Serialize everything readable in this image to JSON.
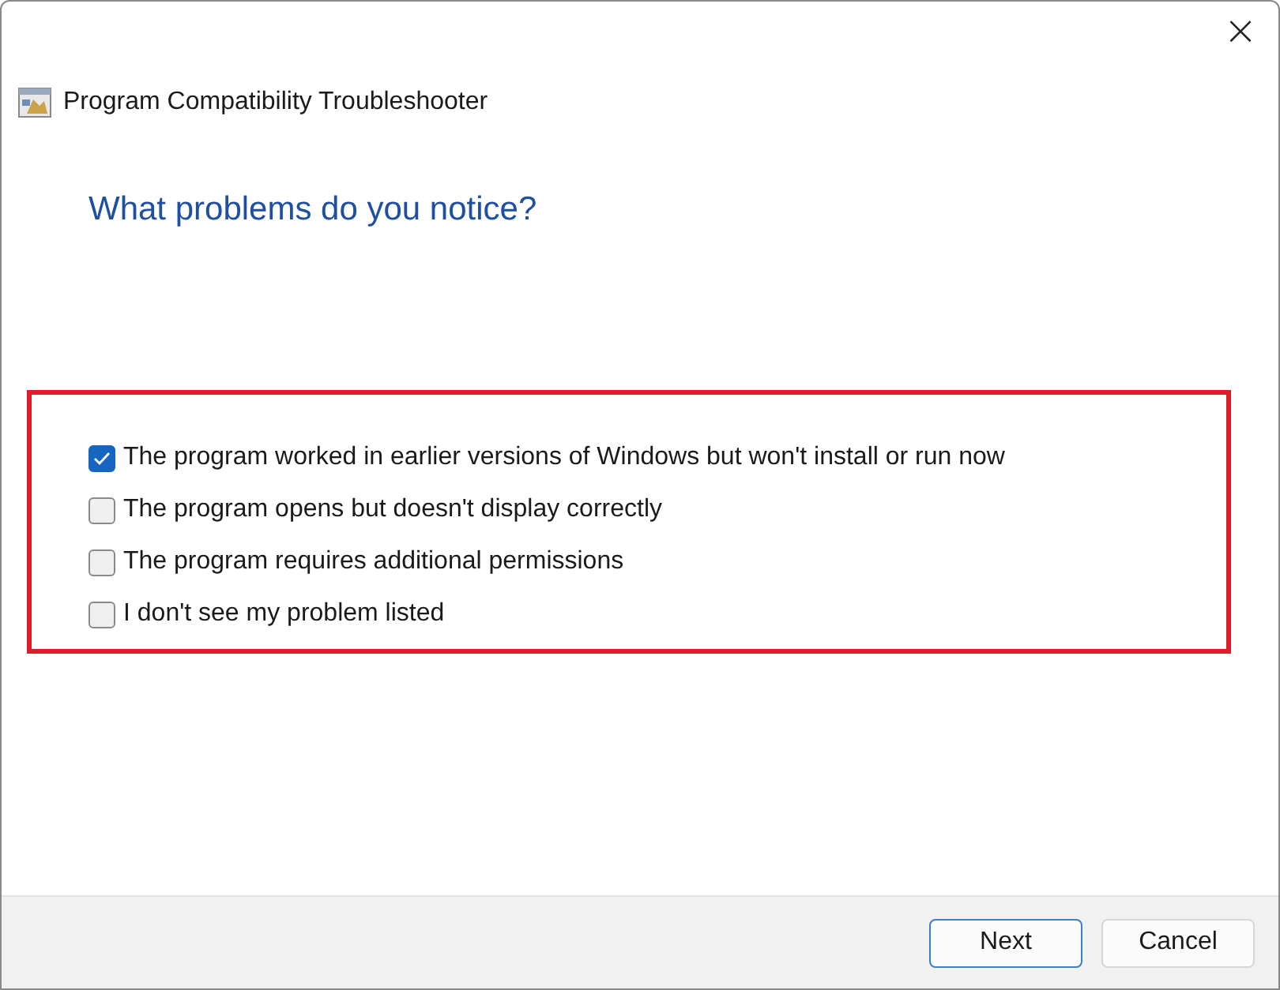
{
  "window": {
    "close": "×"
  },
  "header": {
    "title": "Program Compatibility Troubleshooter"
  },
  "heading": "What problems do you notice?",
  "options": [
    {
      "label": "The program worked in earlier versions of Windows but won't install or run now",
      "checked": true
    },
    {
      "label": "The program opens but doesn't display correctly",
      "checked": false
    },
    {
      "label": "The program requires additional permissions",
      "checked": false
    },
    {
      "label": "I don't see my problem listed",
      "checked": false
    }
  ],
  "buttons": [
    {
      "label": "Next",
      "kind": "primary"
    },
    {
      "label": "Cancel",
      "kind": "secondary"
    }
  ]
}
